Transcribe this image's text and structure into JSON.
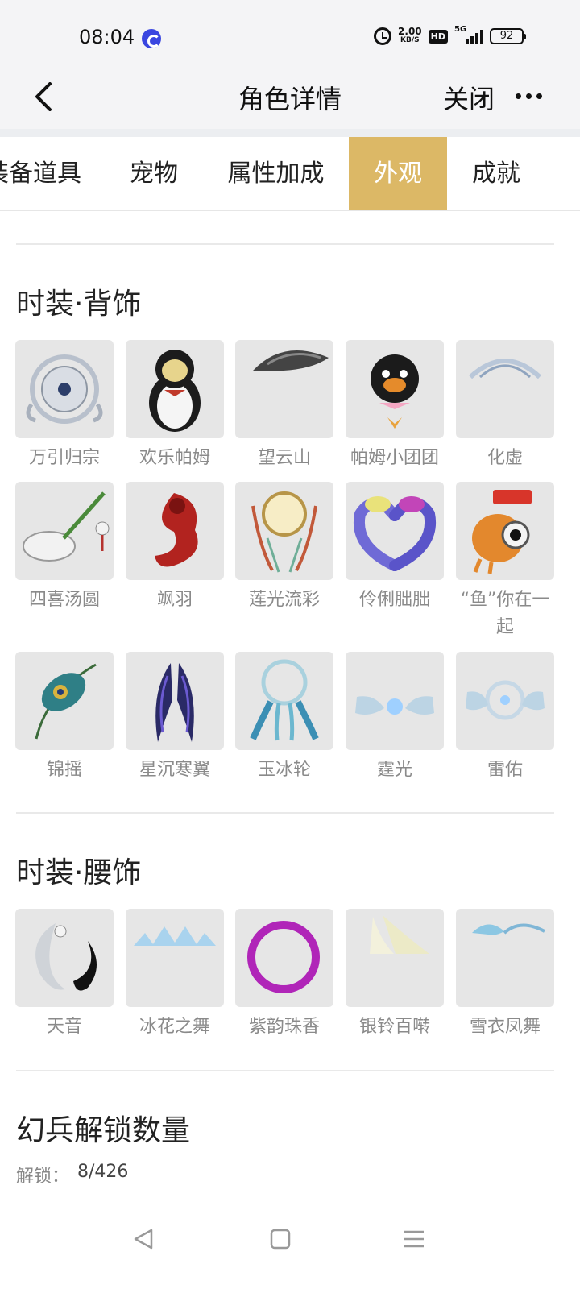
{
  "status_bar": {
    "time": "08:04",
    "net_speed_value": "2.00",
    "net_speed_unit": "KB/S",
    "hd_label": "HD",
    "signal_label": "5G",
    "battery_level": "92"
  },
  "header": {
    "title": "角色详情",
    "close_label": "关闭"
  },
  "tabs": [
    {
      "label": "装备道具",
      "active": false
    },
    {
      "label": "宠物",
      "active": false
    },
    {
      "label": "属性加成",
      "active": false
    },
    {
      "label": "外观",
      "active": true
    },
    {
      "label": "成就",
      "active": false
    }
  ],
  "sections": {
    "back_ornaments": {
      "title": "时装·背饰",
      "items": [
        {
          "name": "万引归宗"
        },
        {
          "name": "欢乐帕姆"
        },
        {
          "name": "望云山"
        },
        {
          "name": "帕姆小团团"
        },
        {
          "name": "化虚"
        },
        {
          "name": "四喜汤圆"
        },
        {
          "name": "飒羽"
        },
        {
          "name": "莲光流彩"
        },
        {
          "name": "伶俐朏朏"
        },
        {
          "name": "“鱼”你在一起"
        },
        {
          "name": "锦摇"
        },
        {
          "name": "星沉寒翼"
        },
        {
          "name": "玉冰轮"
        },
        {
          "name": "霆光"
        },
        {
          "name": "雷佑"
        }
      ]
    },
    "waist_ornaments": {
      "title": "时装·腰饰",
      "items": [
        {
          "name": "天音"
        },
        {
          "name": "冰花之舞"
        },
        {
          "name": "紫韵珠香"
        },
        {
          "name": "银铃百啭"
        },
        {
          "name": "雪衣凤舞"
        }
      ]
    },
    "weapon_unlock": {
      "title": "幻兵解锁数量",
      "label": "解锁：",
      "value": "8/426"
    }
  },
  "colors": {
    "accent": "#dcb866",
    "thumb_bg": "#e6e6e6",
    "label_gray": "#8a8a8a"
  }
}
